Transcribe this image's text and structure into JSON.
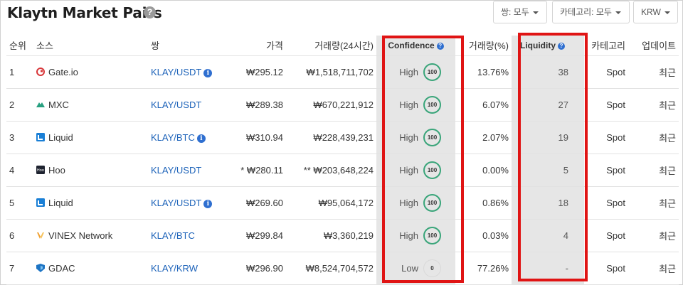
{
  "header": {
    "title": "Klaytn Market Pairs",
    "help": "?"
  },
  "filters": [
    {
      "label": "쌍: 모두"
    },
    {
      "label": "카테고리: 모두"
    },
    {
      "label": "KRW"
    }
  ],
  "columns": {
    "rank": "순위",
    "source": "소스",
    "pair": "쌍",
    "price": "가격",
    "volume": "거래량(24시간)",
    "confidence": "Confidence",
    "volume_pct": "거래량(%)",
    "liquidity": "Liquidity",
    "category": "카테고리",
    "updated": "업데이트"
  },
  "rows": [
    {
      "rank": "1",
      "source": "Gate.io",
      "icon": "gateio-icon",
      "pair": "KLAY/USDT",
      "info": true,
      "price": "₩295.12",
      "volume": "₩1,518,711,702",
      "conf_label": "High",
      "conf_score": "100",
      "volume_pct": "13.76%",
      "liquidity": "38",
      "category": "Spot",
      "updated": "최근"
    },
    {
      "rank": "2",
      "source": "MXC",
      "icon": "mxc-icon",
      "pair": "KLAY/USDT",
      "info": false,
      "price": "₩289.38",
      "volume": "₩670,221,912",
      "conf_label": "High",
      "conf_score": "100",
      "volume_pct": "6.07%",
      "liquidity": "27",
      "category": "Spot",
      "updated": "최근"
    },
    {
      "rank": "3",
      "source": "Liquid",
      "icon": "liquid-icon",
      "pair": "KLAY/BTC",
      "info": true,
      "price": "₩310.94",
      "volume": "₩228,439,231",
      "conf_label": "High",
      "conf_score": "100",
      "volume_pct": "2.07%",
      "liquidity": "19",
      "category": "Spot",
      "updated": "최근"
    },
    {
      "rank": "4",
      "source": "Hoo",
      "icon": "hoo-icon",
      "pair": "KLAY/USDT",
      "info": false,
      "price": "* ₩280.11",
      "volume": "** ₩203,648,224",
      "conf_label": "High",
      "conf_score": "100",
      "volume_pct": "0.00%",
      "liquidity": "5",
      "category": "Spot",
      "updated": "최근"
    },
    {
      "rank": "5",
      "source": "Liquid",
      "icon": "liquid-icon",
      "pair": "KLAY/USDT",
      "info": true,
      "price": "₩269.60",
      "volume": "₩95,064,172",
      "conf_label": "High",
      "conf_score": "100",
      "volume_pct": "0.86%",
      "liquidity": "18",
      "category": "Spot",
      "updated": "최근"
    },
    {
      "rank": "6",
      "source": "VINEX Network",
      "icon": "vinex-icon",
      "pair": "KLAY/BTC",
      "info": false,
      "price": "₩299.84",
      "volume": "₩3,360,219",
      "conf_label": "High",
      "conf_score": "100",
      "volume_pct": "0.03%",
      "liquidity": "4",
      "category": "Spot",
      "updated": "최근"
    },
    {
      "rank": "7",
      "source": "GDAC",
      "icon": "gdac-icon",
      "pair": "KLAY/KRW",
      "info": false,
      "price": "₩296.90",
      "volume": "₩8,524,704,572",
      "conf_label": "Low",
      "conf_score": "0",
      "volume_pct": "77.26%",
      "liquidity": "-",
      "category": "Spot",
      "updated": "최근"
    }
  ],
  "colors": {
    "accent_link": "#1c62b9",
    "highlight_border": "#e01414",
    "high_ring": "#3aa57a",
    "column_shade": "#e6e6e6"
  }
}
